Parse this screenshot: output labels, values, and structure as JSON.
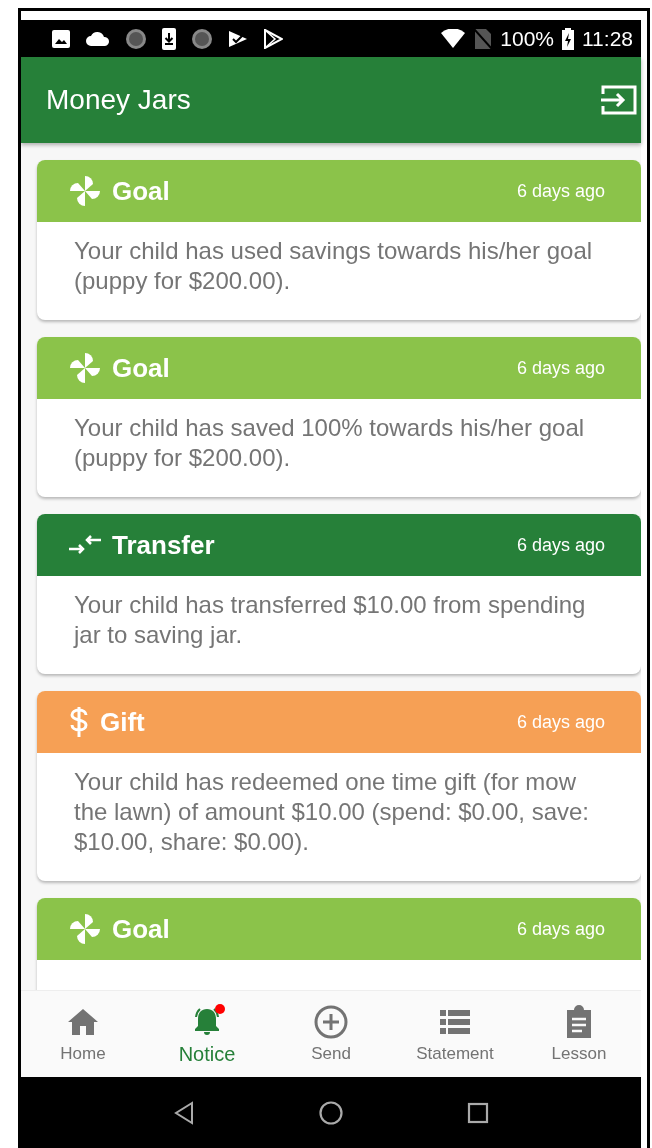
{
  "status_bar": {
    "battery": "100%",
    "time": "11:28"
  },
  "app_bar": {
    "title": "Money Jars"
  },
  "notices": [
    {
      "kind": "goal",
      "color": "#8bc34a",
      "title": "Goal",
      "time": "6 days ago",
      "message": "Your child has used savings towards his/her goal (puppy for $200.00)."
    },
    {
      "kind": "goal",
      "color": "#8bc34a",
      "title": "Goal",
      "time": "6 days ago",
      "message": "Your child has saved 100% towards his/her goal (puppy for $200.00)."
    },
    {
      "kind": "transfer",
      "color": "#268039",
      "title": "Transfer",
      "time": "6 days ago",
      "message": "Your child has transferred $10.00 from spending jar to saving jar."
    },
    {
      "kind": "gift",
      "color": "#f6a055",
      "title": "Gift",
      "time": "6 days ago",
      "message": "Your child has redeemed one time gift (for mow the lawn) of amount $10.00 (spend: $0.00, save: $10.00, share: $0.00)."
    },
    {
      "kind": "goal",
      "color": "#8bc34a",
      "title": "Goal",
      "time": "6 days ago"
    }
  ],
  "bottom_nav": [
    {
      "kind": "home",
      "label": "Home",
      "selected": false,
      "badge": false
    },
    {
      "kind": "notice",
      "label": "Notice",
      "selected": true,
      "badge": true
    },
    {
      "kind": "send",
      "label": "Send",
      "selected": false,
      "badge": false
    },
    {
      "kind": "statement",
      "label": "Statement",
      "selected": false,
      "badge": false
    },
    {
      "kind": "lesson",
      "label": "Lesson",
      "selected": false,
      "badge": false
    }
  ]
}
